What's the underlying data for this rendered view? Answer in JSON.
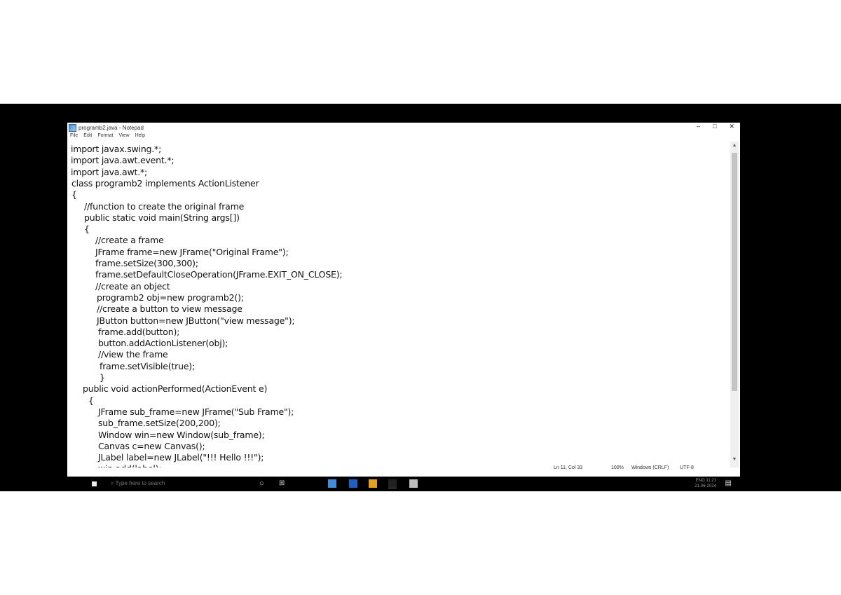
{
  "window": {
    "title": "programb2.java - Notepad",
    "minimize": "–",
    "maximize": "□",
    "close": "✕"
  },
  "menu": [
    "File",
    "Edit",
    "Format",
    "View",
    "Help"
  ],
  "code_lines": [
    "import javax.swing.*;",
    "import java.awt.event.*;",
    "import java.awt.*;",
    "class programb2 implements ActionListener",
    "{",
    "    //function to create the original frame",
    "    public static void main(String args[])",
    "    {",
    "        //create a frame",
    "        JFrame frame=new JFrame(\"Original Frame\");",
    "        frame.setSize(300,300);",
    "        frame.setDefaultCloseOperation(JFrame.EXIT_ON_CLOSE);",
    "        //create an object",
    "        programb2 obj=new programb2();",
    "        //create a button to view message",
    "        JButton button=new JButton(\"view message\");",
    "        frame.add(button);",
    "        button.addActionListener(obj);",
    "        //view the frame",
    "        frame.setVisible(true);",
    "    }",
    "public void actionPerformed(ActionEvent e)",
    "  {",
    "        JFrame sub_frame=new JFrame(\"Sub Frame\");",
    "        sub_frame.setSize(200,200);",
    "        Window win=new Window(sub_frame);",
    "        Canvas c=new Canvas();",
    "        JLabel label=new JLabel(\"!!! Hello !!!\");",
    "        win.add(label);"
  ],
  "status": {
    "position": "Ln 11, Col 33",
    "zoom": "100%",
    "line_ending": "Windows (CRLF)",
    "encoding": "UTF-8"
  },
  "taskbar": {
    "search_placeholder": "Type here to search",
    "time": "11:21",
    "date": "21-06-2024",
    "language": "ENG"
  },
  "icons": {
    "app": "notepad-icon",
    "start": "windows-start-icon",
    "search": "search-icon",
    "task_view": "task-view-icon",
    "notifications": "notification-icon"
  }
}
